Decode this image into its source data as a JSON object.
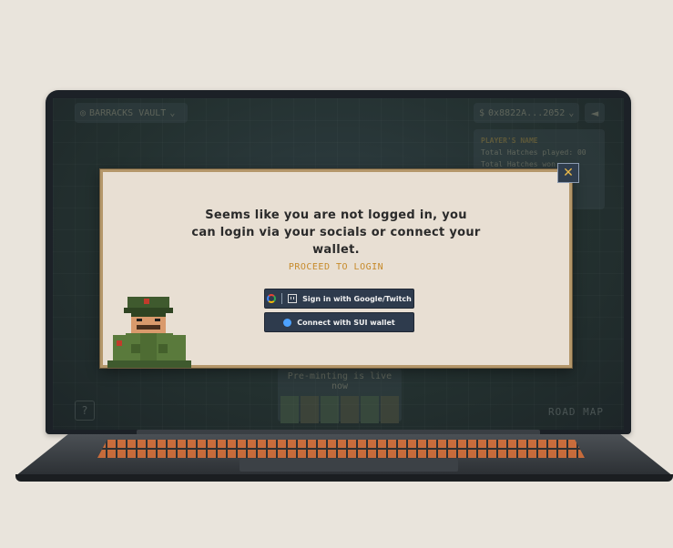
{
  "screen": {
    "vault_label": "BARRACKS VAULT",
    "wallet_label": "0x8822A...2052",
    "player_card": {
      "name": "PLAYER'S NAME",
      "line1_label": "Total Hatches played:",
      "line1_value": "00",
      "line2_label": "Total Hatches won:"
    },
    "preminting_label": "Pre-minting is live now",
    "help_label": "?",
    "roadmap_label": "ROAD MAP"
  },
  "modal": {
    "close_glyph": "✕",
    "message_lines": [
      "Seems like you are not logged in, you",
      "can login via your socials or connect your",
      "wallet."
    ],
    "proceed_label": "PROCEED TO LOGIN",
    "google_button_label": "Sign in with Google/Twitch",
    "sui_button_label": "Connect with SUI wallet"
  },
  "icons": {
    "google": "google-icon",
    "twitch": "twitch-icon",
    "sui": "sui-icon",
    "close": "close-icon",
    "sound": "speaker-icon",
    "money_bag": "money-bag-icon"
  },
  "colors": {
    "modal_bg": "#e8dfd3",
    "modal_border": "#b4976a",
    "button_bg": "#2e3b4d",
    "accent": "#c68a2a",
    "close_x": "#e9b84a"
  }
}
